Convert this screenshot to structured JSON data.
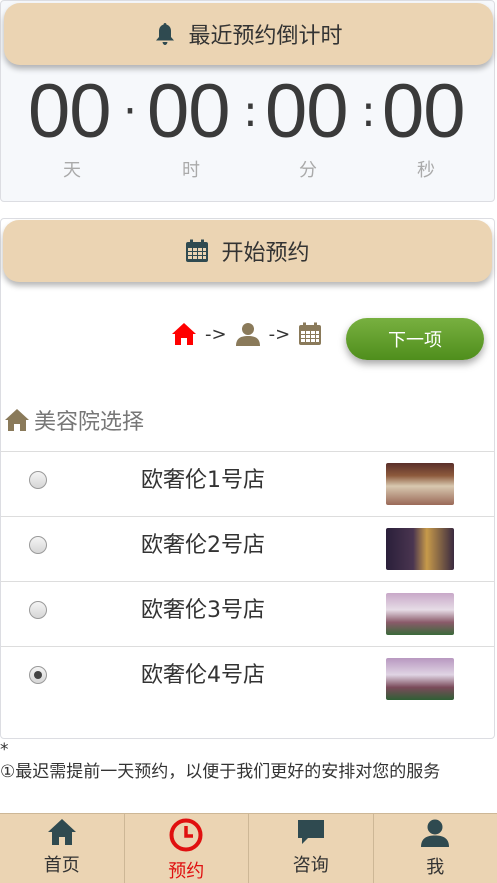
{
  "countdown": {
    "title": "最近预约倒计时",
    "days": "00",
    "hours": "00",
    "minutes": "00",
    "seconds": "00",
    "units": {
      "day": "天",
      "hour": "时",
      "minute": "分",
      "second": "秒"
    }
  },
  "booking": {
    "title": "开始预约",
    "steps": {
      "arrow1": "->",
      "arrow2": "->",
      "active_color": "#ff0000",
      "inactive_color": "#8a7a5a"
    },
    "next_button": "下一项",
    "section_title": "美容院选择",
    "stores": [
      {
        "name": "欧奢伦1号店",
        "checked": false,
        "thumb": "storefront-photo-1"
      },
      {
        "name": "欧奢伦2号店",
        "checked": false,
        "thumb": "storefront-photo-2"
      },
      {
        "name": "欧奢伦3号店",
        "checked": false,
        "thumb": "storefront-photo-3"
      },
      {
        "name": "欧奢伦4号店",
        "checked": true,
        "thumb": "storefront-photo-4"
      }
    ]
  },
  "notes": {
    "star": "*",
    "line1": "①最迟需提前一天预约，以便于我们更好的安排对您的服务"
  },
  "tabbar": {
    "items": [
      {
        "label": "首页",
        "icon": "home-icon"
      },
      {
        "label": "预约",
        "icon": "clock-icon",
        "active": true
      },
      {
        "label": "咨询",
        "icon": "chat-icon"
      },
      {
        "label": "我",
        "icon": "user-icon"
      }
    ]
  },
  "colors": {
    "header_bg": "#ebd4b3",
    "next_button": "#5c9a26",
    "active_tab": "#e01010"
  }
}
